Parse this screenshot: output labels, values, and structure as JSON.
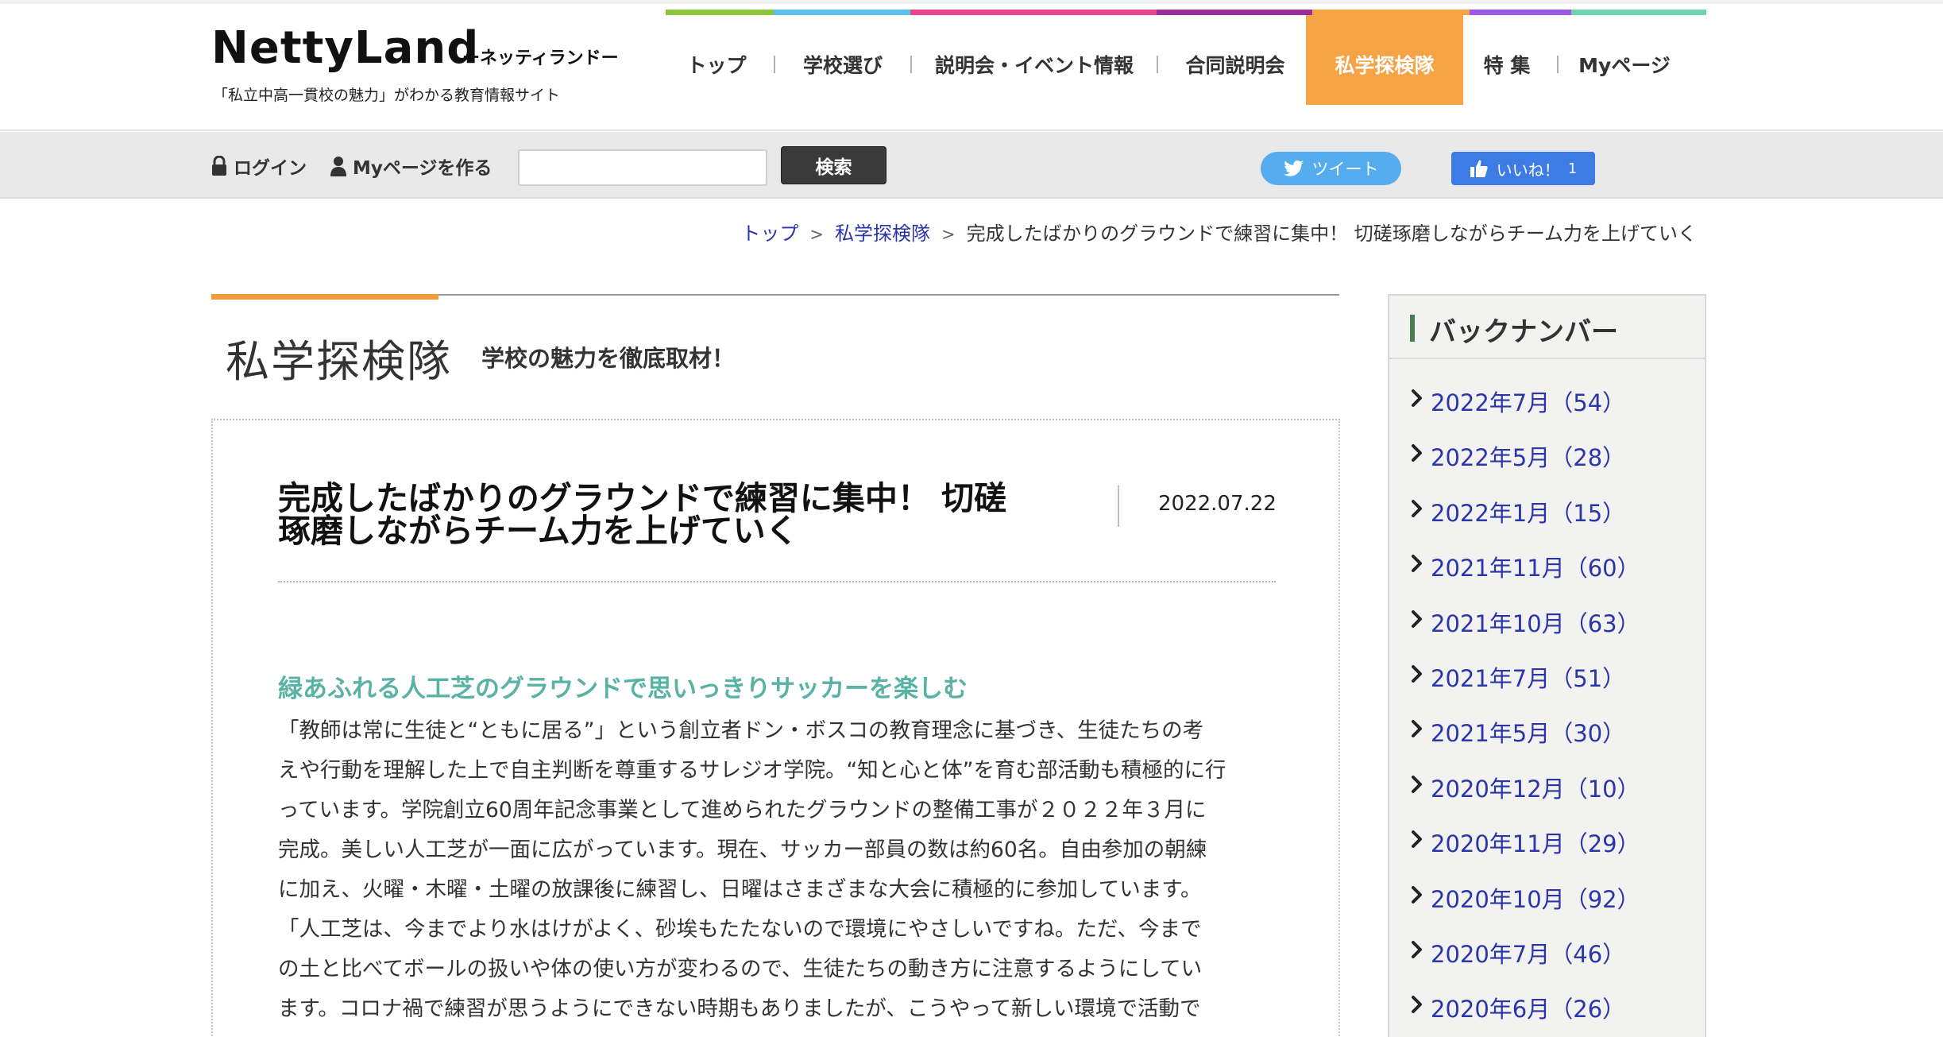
{
  "brand": {
    "logo": "NettyLand",
    "logo_sub": "ーネッティランドー",
    "tagline": "「私立中高一貫校の魅力」がわかる教育情報サイト"
  },
  "nav": {
    "items": [
      {
        "label": "トップ",
        "stripe": "#8cc63f"
      },
      {
        "label": "学校選び",
        "stripe": "#5bc0eb"
      },
      {
        "label": "説明会・イベント情報",
        "stripe": "#e8458b"
      },
      {
        "label": "合同説明会",
        "stripe": "#9b2d9a"
      },
      {
        "label": "私学探検隊",
        "stripe": "#f4a345",
        "active": true
      },
      {
        "label": "特 集",
        "stripe": "#9b59e8"
      },
      {
        "label": "Myページ",
        "stripe": "#6fd3b0"
      }
    ]
  },
  "utility": {
    "login": "ログイン",
    "create_mypage": "Myページを作る",
    "search_value": "",
    "search_button": "検索",
    "tweet": "ツイート",
    "like": "いいね！",
    "like_count": "1"
  },
  "breadcrumb": {
    "home": "トップ",
    "section": "私学探検隊",
    "current": "完成したばかりのグラウンドで練習に集中！ 切磋琢磨しながらチーム力を上げていく",
    "separator": ">"
  },
  "section": {
    "title": "私学探検隊",
    "subtitle": "学校の魅力を徹底取材！"
  },
  "article": {
    "title_line1": "完成したばかりのグラウンドで練習に集中！ 切磋",
    "title_line2": "琢磨しながらチーム力を上げていく",
    "date": "2022.07.22",
    "subhead": "緑あふれる人工芝のグラウンドで思いっきりサッカーを楽しむ",
    "body_lines": [
      "「教師は常に生徒と“ともに居る”」という創立者ドン・ボスコの教育理念に基づき、生徒たちの考",
      "えや行動を理解した上で自主判断を尊重するサレジオ学院。“知と心と体”を育む部活動も積極的に行",
      "っています。学院創立60周年記念事業として進められたグラウンドの整備工事が２０２２年３月に",
      "完成。美しい人工芝が一面に広がっています。現在、サッカー部員の数は約60名。自由参加の朝練",
      "に加え、火曜・木曜・土曜の放課後に練習し、日曜はさまざまな大会に積極的に参加しています。",
      "「人工芝は、今までより水はけがよく、砂埃もたたないので環境にやさしいですね。ただ、今まで",
      "の土と比べてボールの扱いや体の使い方が変わるので、生徒たちの動き方に注意するようにしてい",
      "ます。コロナ禍で練習が思うようにできない時期もありましたが、こうやって新しい環境で活動で"
    ]
  },
  "sidebar": {
    "title": "バックナンバー",
    "items": [
      "2022年7月（54）",
      "2022年5月（28）",
      "2022年1月（15）",
      "2021年11月（60）",
      "2021年10月（63）",
      "2021年7月（51）",
      "2021年5月（30）",
      "2020年12月（10）",
      "2020年11月（29）",
      "2020年10月（92）",
      "2020年7月（46）",
      "2020年6月（26）"
    ]
  },
  "icons": {
    "login": "lock-icon",
    "mypage": "person-icon",
    "tweet": "twitter-bird-icon",
    "like": "thumbs-up-icon",
    "list": "chevron-right-icon"
  },
  "colors": {
    "active_nav": "#f4a345",
    "link": "#2b35a8",
    "subhead": "#58b3a4",
    "section_accent": "#f29a3c"
  }
}
